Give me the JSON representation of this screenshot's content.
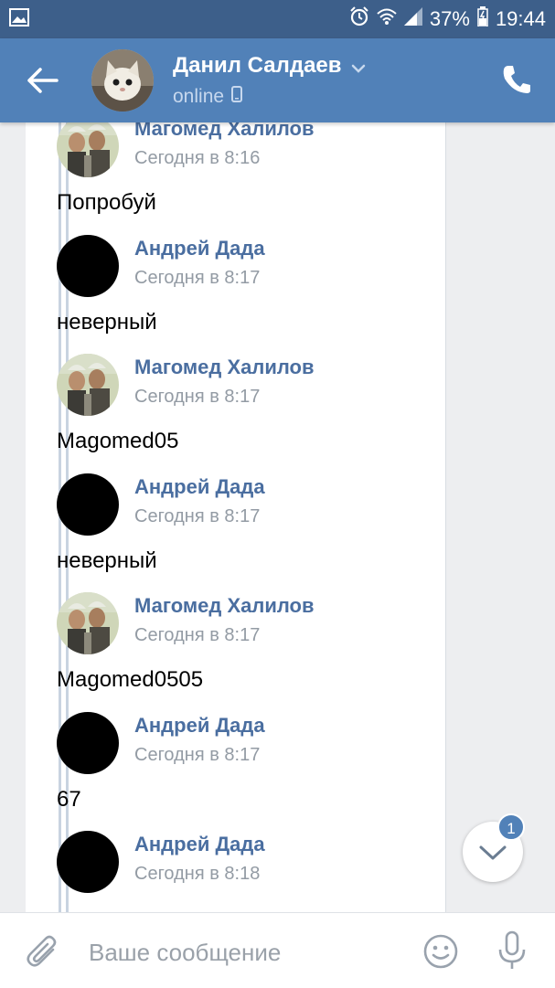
{
  "status_bar": {
    "battery": "37%",
    "time": "19:44"
  },
  "header": {
    "name": "Данил Салдаев",
    "status": "online"
  },
  "messages": [
    {
      "author": "Магомед Халилов",
      "time": "Сегодня в 8:16",
      "avatar": "photo",
      "text": "Попробуй"
    },
    {
      "author": "Андрей Дада",
      "time": "Сегодня в 8:17",
      "avatar": "black",
      "text": "неверный"
    },
    {
      "author": "Магомед Халилов",
      "time": "Сегодня в 8:17",
      "avatar": "photo",
      "text": "Magomed05"
    },
    {
      "author": "Андрей Дада",
      "time": "Сегодня в 8:17",
      "avatar": "black",
      "text": "неверный"
    },
    {
      "author": "Магомед Халилов",
      "time": "Сегодня в 8:17",
      "avatar": "photo",
      "text": "Magomed0505"
    },
    {
      "author": "Андрей Дада",
      "time": "Сегодня в 8:17",
      "avatar": "black",
      "text": "67"
    },
    {
      "author": "Андрей Дада",
      "time": "Сегодня в 8:18",
      "avatar": "black",
      "text": ""
    }
  ],
  "scroll_down": {
    "badge": "1"
  },
  "composer": {
    "placeholder": "Ваше сообщение"
  },
  "colors": {
    "status_bar": "#3d5f8a",
    "header": "#5181b8",
    "author_link": "#4a6ea0"
  }
}
